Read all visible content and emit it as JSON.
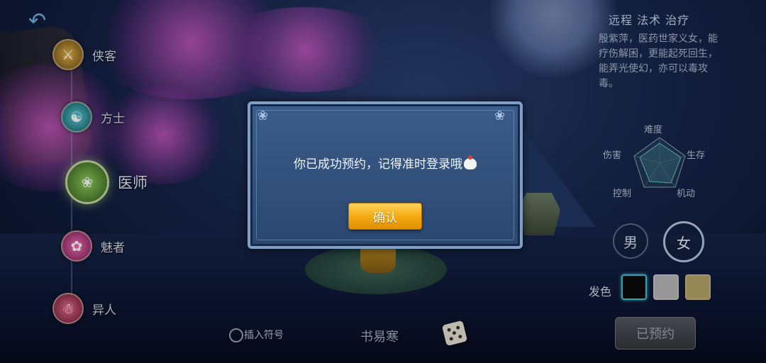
{
  "classes": [
    {
      "label": "侠客",
      "icon": "warrior-icon"
    },
    {
      "label": "方士",
      "icon": "taiji-icon"
    },
    {
      "label": "医师",
      "icon": "lotus-icon",
      "selected": true
    },
    {
      "label": "魅者",
      "icon": "fox-icon"
    },
    {
      "label": "异人",
      "icon": "spirit-icon"
    }
  ],
  "info": {
    "tags": "远程 法术 治疗",
    "description": "殷紫萍，医药世家义女，能疗伤解困，更能起死回生，能弄光使幻，亦可以毒攻毒。"
  },
  "radar": {
    "labels": {
      "top": "难度",
      "left": "伤害",
      "right": "生存",
      "bottom_left": "控制",
      "bottom_right": "机动"
    }
  },
  "gender": {
    "male": "男",
    "female": "女",
    "selected": "female"
  },
  "hair_color": {
    "label": "发色",
    "swatches": [
      "#0a0a0a",
      "#b9b9b9",
      "#b8a56a"
    ],
    "selected_index": 0
  },
  "reserve_button": "已预约",
  "chat": {
    "insert_symbol": "插入符号",
    "name": "书易寒"
  },
  "dialog": {
    "message": "你已成功预约，记得准时登录哦",
    "confirm": "确认"
  }
}
